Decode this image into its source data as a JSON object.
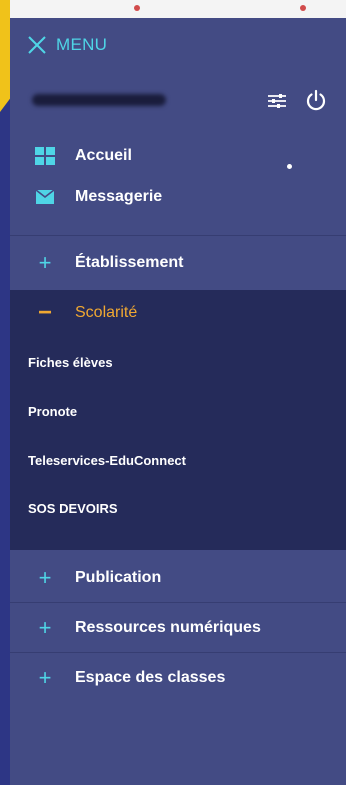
{
  "header": {
    "menu_label": "MENU"
  },
  "icons": {
    "close": "close-icon",
    "settings": "sliders-icon",
    "power": "power-icon",
    "home": "grid-icon",
    "messages": "envelope-icon",
    "expand": "plus-icon",
    "collapse": "minus-icon"
  },
  "nav": {
    "accueil": "Accueil",
    "messagerie": "Messagerie",
    "etablissement": "Établissement",
    "scolarite": "Scolarité",
    "publication": "Publication",
    "ressources": "Ressources numériques",
    "espace": "Espace des classes"
  },
  "scolarite_items": [
    "Fiches élèves",
    "Pronote",
    "Teleservices-EduConnect",
    "SOS DEVOIRS"
  ],
  "colors": {
    "accent_cyan": "#4fd5e6",
    "accent_orange": "#f0a832",
    "panel": "#434b84",
    "expanded_panel": "#252b5a",
    "yellow_corner": "#f0c21a"
  }
}
